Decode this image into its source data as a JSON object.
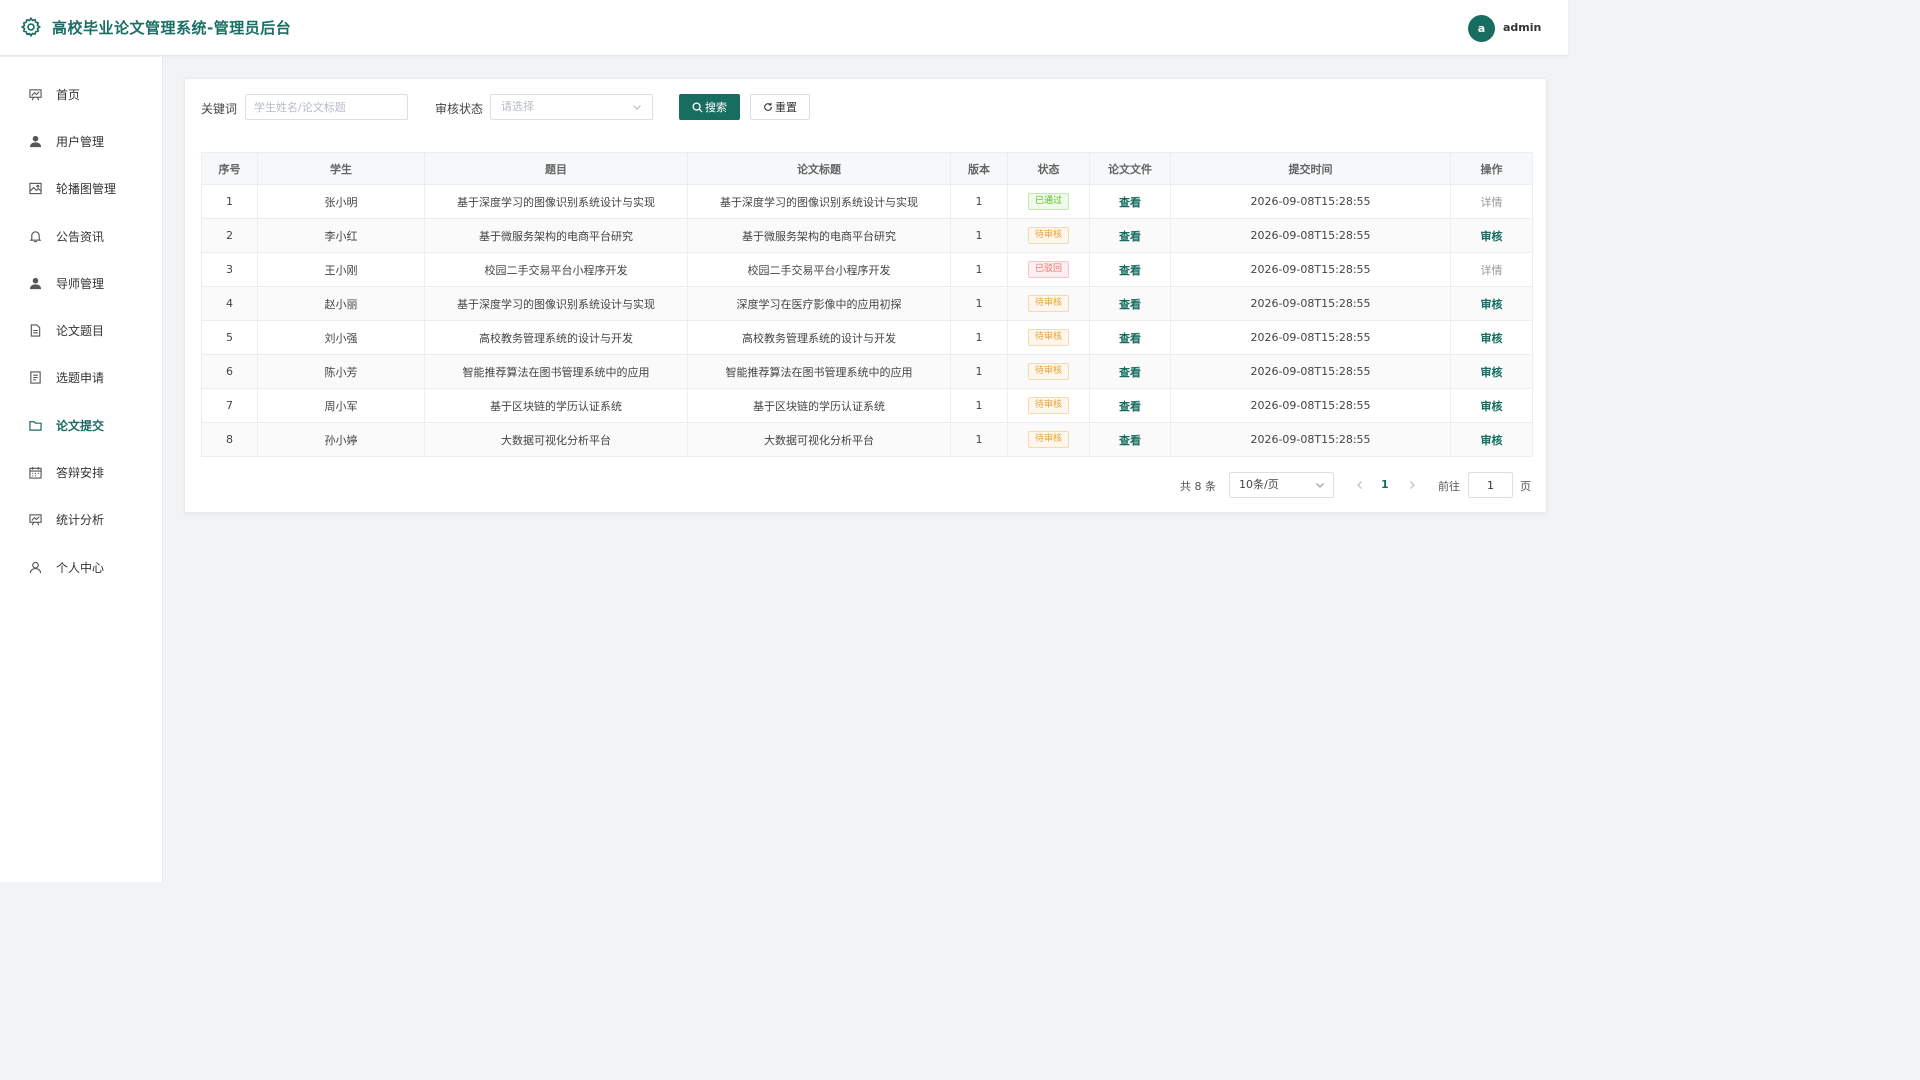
{
  "header": {
    "title": "高校毕业论文管理系统-管理员后台",
    "avatar_letter": "a",
    "username": "admin"
  },
  "sidebar": {
    "items": [
      {
        "label": "首页",
        "icon": "home-chart-icon"
      },
      {
        "label": "用户管理",
        "icon": "user-icon"
      },
      {
        "label": "轮播图管理",
        "icon": "image-icon"
      },
      {
        "label": "公告资讯",
        "icon": "bell-icon"
      },
      {
        "label": "导师管理",
        "icon": "user-icon"
      },
      {
        "label": "论文题目",
        "icon": "document-icon"
      },
      {
        "label": "选题申请",
        "icon": "tickets-icon"
      },
      {
        "label": "论文提交",
        "icon": "folder-icon",
        "active": true
      },
      {
        "label": "答辩安排",
        "icon": "calendar-icon"
      },
      {
        "label": "统计分析",
        "icon": "data-board-icon"
      },
      {
        "label": "个人中心",
        "icon": "user-outline-icon"
      }
    ]
  },
  "filter": {
    "keyword_label": "关键词",
    "keyword_placeholder": "学生姓名/论文标题",
    "keyword_value": "",
    "status_label": "审核状态",
    "status_placeholder": "请选择",
    "search_label": "搜索",
    "reset_label": "重置"
  },
  "table": {
    "columns": [
      "序号",
      "学生",
      "题目",
      "论文标题",
      "版本",
      "状态",
      "论文文件",
      "提交时间",
      "操作"
    ],
    "rows": [
      {
        "no": "1",
        "student": "张小明",
        "topic": "基于深度学习的图像识别系统设计与实现",
        "thesis_title": "基于深度学习的图像识别系统设计与实现",
        "version": "1",
        "status": "已通过",
        "file": "查看",
        "time": "2026-09-08T15:28:55",
        "action": "详情"
      },
      {
        "no": "2",
        "student": "李小红",
        "topic": "基于微服务架构的电商平台研究",
        "thesis_title": "基于微服务架构的电商平台研究",
        "version": "1",
        "status": "待审核",
        "file": "查看",
        "time": "2026-09-08T15:28:55",
        "action": "审核"
      },
      {
        "no": "3",
        "student": "王小刚",
        "topic": "校园二手交易平台小程序开发",
        "thesis_title": "校园二手交易平台小程序开发",
        "version": "1",
        "status": "已驳回",
        "file": "查看",
        "time": "2026-09-08T15:28:55",
        "action": "详情"
      },
      {
        "no": "4",
        "student": "赵小丽",
        "topic": "基于深度学习的图像识别系统设计与实现",
        "thesis_title": "深度学习在医疗影像中的应用初探",
        "version": "1",
        "status": "待审核",
        "file": "查看",
        "time": "2026-09-08T15:28:55",
        "action": "审核"
      },
      {
        "no": "5",
        "student": "刘小强",
        "topic": "高校教务管理系统的设计与开发",
        "thesis_title": "高校教务管理系统的设计与开发",
        "version": "1",
        "status": "待审核",
        "file": "查看",
        "time": "2026-09-08T15:28:55",
        "action": "审核"
      },
      {
        "no": "6",
        "student": "陈小芳",
        "topic": "智能推荐算法在图书管理系统中的应用",
        "thesis_title": "智能推荐算法在图书管理系统中的应用",
        "version": "1",
        "status": "待审核",
        "file": "查看",
        "time": "2026-09-08T15:28:55",
        "action": "审核"
      },
      {
        "no": "7",
        "student": "周小军",
        "topic": "基于区块链的学历认证系统",
        "thesis_title": "基于区块链的学历认证系统",
        "version": "1",
        "status": "待审核",
        "file": "查看",
        "time": "2026-09-08T15:28:55",
        "action": "审核"
      },
      {
        "no": "8",
        "student": "孙小婷",
        "topic": "大数据可视化分析平台",
        "thesis_title": "大数据可视化分析平台",
        "version": "1",
        "status": "待审核",
        "file": "查看",
        "time": "2026-09-08T15:28:55",
        "action": "审核"
      }
    ]
  },
  "pagination": {
    "total_text": "共 8 条",
    "page_size": "10条/页",
    "current_page": "1",
    "goto_label": "前往",
    "goto_value": "1",
    "page_suffix": "页"
  },
  "colors": {
    "primary": "#176d60",
    "status_pass": "#52c41a",
    "status_wait": "#e6a23c",
    "status_reject": "#f56c6c"
  }
}
